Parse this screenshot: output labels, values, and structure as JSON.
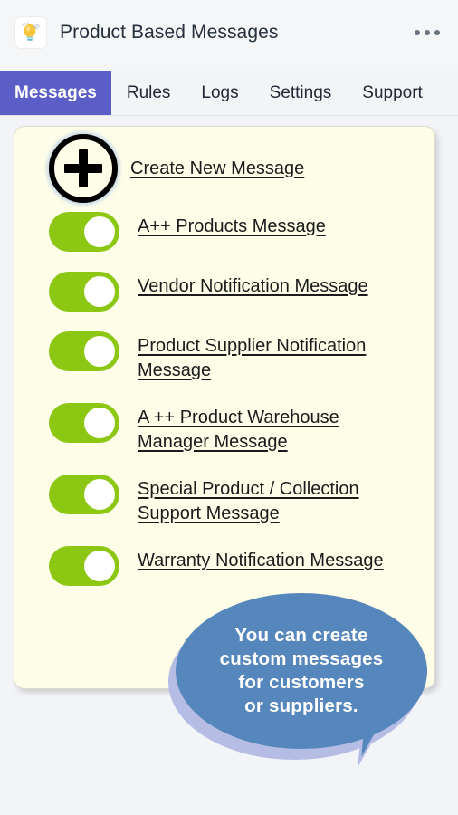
{
  "header": {
    "title": "Product Based Messages",
    "logo_icon": "lightbulb-pencil-icon",
    "overflow_icon": "more-options-icon"
  },
  "tabs": [
    {
      "label": "Messages",
      "active": true
    },
    {
      "label": "Rules",
      "active": false
    },
    {
      "label": "Logs",
      "active": false
    },
    {
      "label": "Settings",
      "active": false
    },
    {
      "label": "Support",
      "active": false
    }
  ],
  "card": {
    "create": {
      "icon": "plus-circle-icon",
      "label": "Create New Message"
    },
    "messages": [
      {
        "label": "A++ Products Message",
        "enabled": true
      },
      {
        "label": "Vendor Notification Message",
        "enabled": true
      },
      {
        "label": "Product Supplier Notification Message",
        "enabled": true
      },
      {
        "label": "A ++ Product Warehouse Manager Message",
        "enabled": true
      },
      {
        "label": "Special Product / Collection Support Message",
        "enabled": true
      },
      {
        "label": "Warranty Notification Message",
        "enabled": true
      }
    ]
  },
  "callout": {
    "text": "You can create\ncustom  messages\nfor customers\nor suppliers."
  },
  "colors": {
    "accent_purple": "#5b5ec6",
    "toggle_green": "#8cc714",
    "callout_blue": "#5586bc",
    "callout_shadow": "#b6bde4",
    "card_background": "#fdfde8",
    "page_background": "#f2f4f7"
  }
}
